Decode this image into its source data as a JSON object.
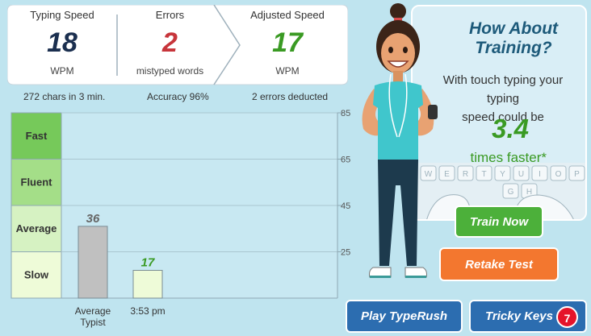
{
  "stats": {
    "typing_speed": {
      "label": "Typing Speed",
      "value": "18",
      "unit": "WPM",
      "color": "#1b2f4f"
    },
    "errors": {
      "label": "Errors",
      "value": "2",
      "unit": "mistyped words",
      "color": "#c7353b"
    },
    "adjusted_speed": {
      "label": "Adjusted Speed",
      "value": "17",
      "unit": "WPM",
      "color": "#3a9a23"
    }
  },
  "summary": {
    "chars": "272 chars in 3 min.",
    "accuracy": "Accuracy 96%",
    "deducted": "2 errors deducted"
  },
  "chart_data": {
    "type": "bar",
    "categories": [
      "Average\nTypist",
      "3:53 pm"
    ],
    "values": [
      36,
      17
    ],
    "bar_colors": [
      "#c0c0c0",
      "#eefbd8"
    ],
    "value_label_colors": [
      "#666666",
      "#3a9a23"
    ],
    "ylim": [
      5,
      85
    ],
    "yticks": [
      25,
      45,
      65,
      85
    ],
    "bands": [
      {
        "label": "Fast",
        "from": 65,
        "to": 85,
        "color": "#76c95a"
      },
      {
        "label": "Fluent",
        "from": 45,
        "to": 65,
        "color": "#a4de88"
      },
      {
        "label": "Average",
        "from": 25,
        "to": 45,
        "color": "#d6f2c2"
      },
      {
        "label": "Slow",
        "from": 5,
        "to": 25,
        "color": "#eefbd8"
      }
    ]
  },
  "promo": {
    "title": "How About Training?",
    "text_line1": "With touch typing your typing",
    "text_line2": "speed could be",
    "factor": "3.4",
    "factor_unit": "times faster*",
    "keyboard_keys": [
      "W",
      "E",
      "R",
      "T",
      "Y",
      "U",
      "I",
      "O",
      "P",
      "G",
      "H"
    ]
  },
  "buttons": {
    "train_now": "Train Now",
    "retake_test": "Retake Test",
    "play_typerush": "Play TypeRush",
    "tricky_keys": "Tricky Keys",
    "tricky_keys_count": "7"
  }
}
